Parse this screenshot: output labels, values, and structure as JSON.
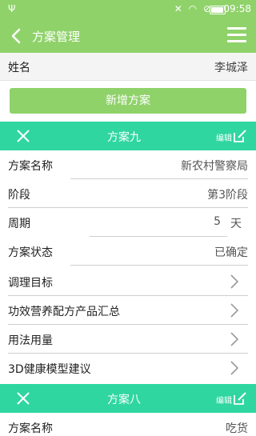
{
  "statusbar": {
    "time": "09:58"
  },
  "header": {
    "title": "方案管理"
  },
  "profile": {
    "name_label": "姓名",
    "name_value": "李城泽"
  },
  "add_button": {
    "label": "新增方案"
  },
  "plans": [
    {
      "title": "方案九",
      "edit_label": "编辑",
      "fields": {
        "name_label": "方案名称",
        "name_value": "新农村警察局",
        "stage_label": "阶段",
        "stage_value": "第3阶段",
        "period_label": "周期",
        "period_value": "5",
        "period_unit": "天",
        "status_label": "方案状态",
        "status_value": "已确定"
      },
      "links": [
        "调理目标",
        "功效营养配方产品汇总",
        "用法用量",
        "3D健康模型建议"
      ]
    },
    {
      "title": "方案八",
      "edit_label": "编辑",
      "fields": {
        "name_label": "方案名称",
        "name_value": "吃货"
      }
    }
  ]
}
